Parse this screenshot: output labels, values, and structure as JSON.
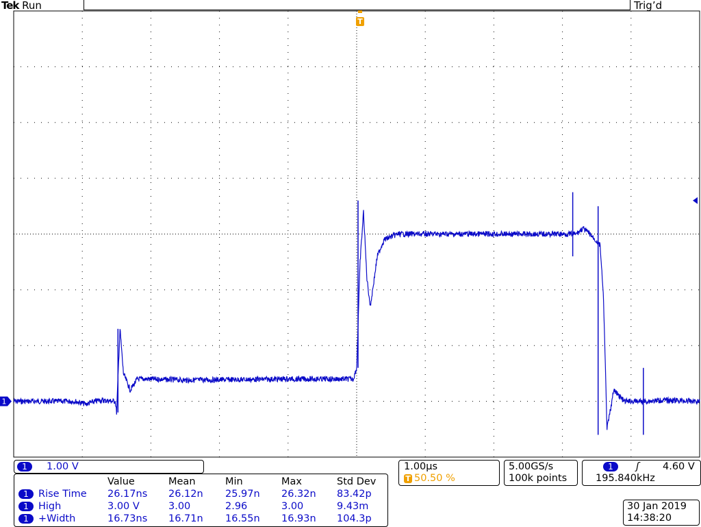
{
  "header": {
    "brand": "Tek",
    "run_state": "Run",
    "trigger_status": "Trig’d",
    "trigger_marker": "T"
  },
  "channel": {
    "number": "1",
    "scale": "1.00 V",
    "color": "#0a0ac8"
  },
  "measurements": {
    "headers": [
      "Value",
      "Mean",
      "Min",
      "Max",
      "Std Dev"
    ],
    "rows": [
      {
        "channel": "1",
        "name": "Rise Time",
        "value": "26.17ns",
        "mean": "26.12n",
        "min": "25.97n",
        "max": "26.32n",
        "std_dev": "83.42p"
      },
      {
        "channel": "1",
        "name": "High",
        "value": "3.00 V",
        "mean": "3.00",
        "min": "2.96",
        "max": "3.00",
        "std_dev": "9.43m"
      },
      {
        "channel": "1",
        "name": "+Width",
        "value": "16.73ns",
        "mean": "16.71n",
        "min": "16.55n",
        "max": "16.93n",
        "std_dev": "104.3p"
      }
    ]
  },
  "timebase": {
    "time_per_div": "1.00µs",
    "trigger_position": "50.50 %"
  },
  "acquisition": {
    "sample_rate": "5.00GS/s",
    "record_length": "100k points"
  },
  "trigger": {
    "source": "1",
    "slope_symbol": "ʃ",
    "level": "4.60 V",
    "frequency": "195.840kHz"
  },
  "datetime": {
    "date": "30 Jan  2019",
    "time": "14:38:20"
  },
  "chart_data": {
    "type": "line",
    "title": "",
    "xlabel": "",
    "ylabel": "",
    "x_unit": "µs",
    "y_unit": "V",
    "xlim": [
      -5,
      5
    ],
    "ylim": [
      -1,
      7
    ],
    "grid": true,
    "series": [
      {
        "name": "",
        "color": "#0a0ac8",
        "x": [
          -5.0,
          -4.1,
          -3.95,
          -3.75,
          -3.52,
          -3.5,
          -3.45,
          -3.4,
          -3.3,
          -3.2,
          -3.0,
          -2.5,
          -1.0,
          -0.05,
          0.0,
          0.05,
          0.1,
          0.15,
          0.2,
          0.3,
          0.4,
          0.6,
          1.0,
          2.0,
          3.0,
          3.2,
          3.3,
          3.4,
          3.55,
          3.6,
          3.65,
          3.75,
          3.9,
          4.2,
          4.5,
          5.0
        ],
        "values": [
          0.0,
          0.0,
          -0.05,
          0.02,
          0.0,
          -0.2,
          1.3,
          0.5,
          0.2,
          0.4,
          0.4,
          0.38,
          0.4,
          0.4,
          0.6,
          2.5,
          3.4,
          2.2,
          1.7,
          2.6,
          2.9,
          3.0,
          3.0,
          3.0,
          3.0,
          3.0,
          3.1,
          3.0,
          2.8,
          1.8,
          -0.5,
          0.2,
          0.0,
          0.0,
          0.02,
          0.0
        ]
      }
    ],
    "annotations": [
      "ground marker channel 1",
      "trigger level arrow at 4.60 V"
    ]
  }
}
